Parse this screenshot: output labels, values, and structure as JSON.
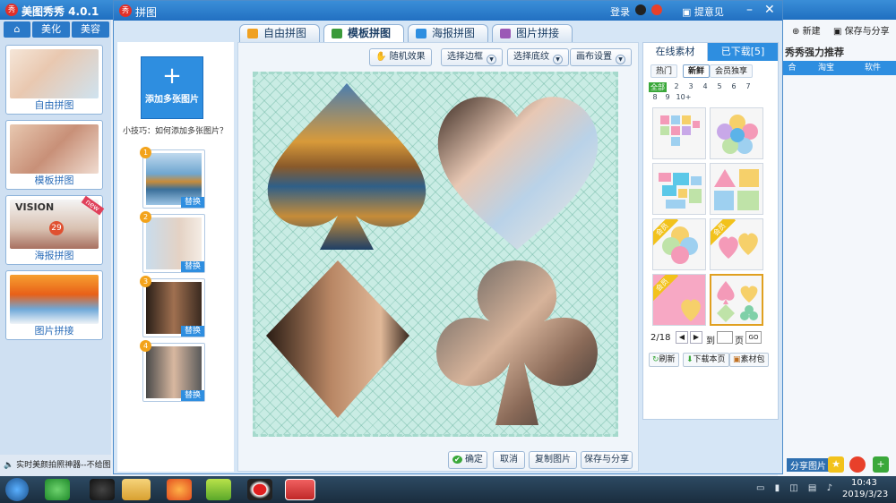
{
  "bg_app": {
    "title": "美图秀秀 4.0.1",
    "tabs": [
      "美化",
      "美容"
    ],
    "templates": [
      {
        "label": "自由拼图"
      },
      {
        "label": "模板拼图"
      },
      {
        "label": "海报拼图",
        "badge": "new",
        "poster_word": "VISION",
        "poster_num": "29"
      },
      {
        "label": "图片拼接"
      }
    ],
    "status": "实时美颜拍照神器--不给图",
    "right_new": "新建",
    "right_save": "保存与分享",
    "right_heading": "秀秀强力推荐",
    "right_links": [
      "合",
      "淘宝",
      "软件"
    ],
    "share_label": "分享图片"
  },
  "dialog": {
    "title": "拼图",
    "login": "登录",
    "feedback": "提意见",
    "tabs": [
      {
        "label": "自由拼图",
        "color": "#f0a020"
      },
      {
        "label": "模板拼图",
        "color": "#3a9a3a",
        "active": true
      },
      {
        "label": "海报拼图",
        "color": "#2e8ee0"
      },
      {
        "label": "图片拼接",
        "color": "#9b59b6"
      }
    ],
    "left": {
      "add_label": "添加多张图片",
      "tip": "小技巧：如何添加多张图片？",
      "slots": [
        {
          "num": "1",
          "replace": "替换"
        },
        {
          "num": "2",
          "replace": "替换"
        },
        {
          "num": "3",
          "replace": "替换"
        },
        {
          "num": "4",
          "replace": "替换"
        }
      ]
    },
    "toolbar": {
      "random": "随机效果",
      "border": "选择边框",
      "shading": "选择底纹",
      "canvas": "画布设置"
    },
    "bottom": {
      "confirm": "确定",
      "cancel": "取消",
      "copy": "复制图片",
      "save_share": "保存与分享"
    },
    "right": {
      "tab_online": "在线素材",
      "tab_downloaded": "已下载[5]",
      "filters": [
        "热门",
        "新鲜",
        "会员独享"
      ],
      "active_filter": "新鲜",
      "pages": [
        "全部",
        "2",
        "3",
        "4",
        "5",
        "6",
        "7",
        "8",
        "9",
        "10+"
      ],
      "member_tag": "会员",
      "page_indicator": "2/18",
      "goto_to": "到",
      "goto_page": "页",
      "goto_btn": "GO",
      "refresh": "刷新",
      "download_page": "下载本页",
      "package": "素材包"
    }
  },
  "taskbar": {
    "clock_time": "10:43",
    "clock_date": "2019/3/23"
  },
  "colors": {
    "accent": "#2e8ee0",
    "title_bar": "#2270c2",
    "collage_bg": "#c9ece4"
  }
}
